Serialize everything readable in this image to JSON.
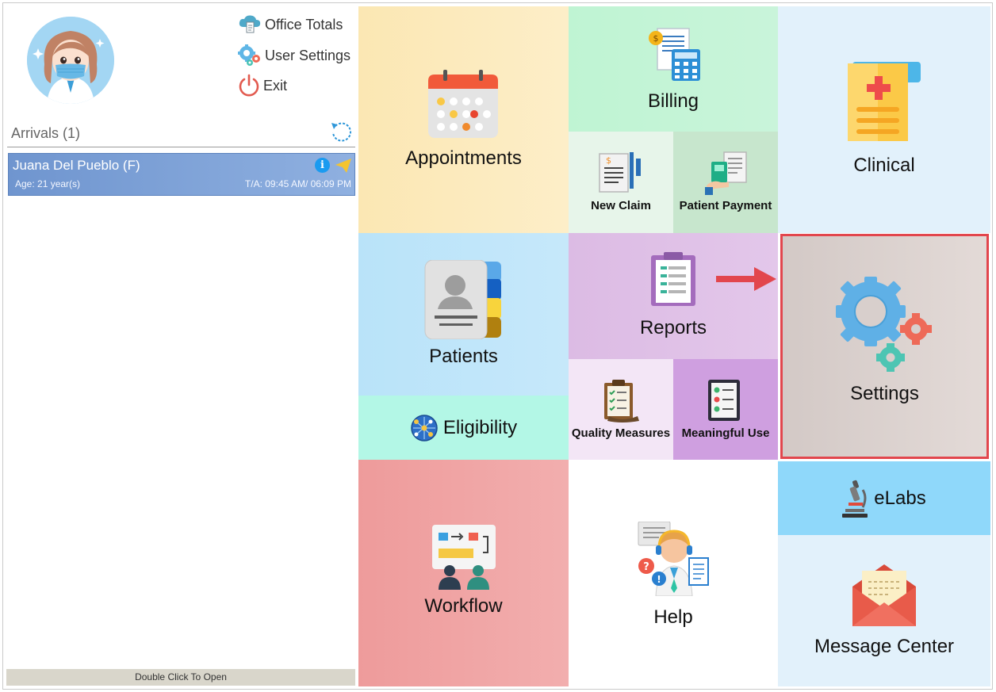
{
  "user_menu": {
    "office_totals": "Office Totals",
    "user_settings": "User Settings",
    "exit": "Exit"
  },
  "arrivals": {
    "title": "Arrivals (1)",
    "patients": [
      {
        "name": "Juana Del Pueblo (F)",
        "age": "Age: 21 year(s)",
        "time": "T/A: 09:45 AM/ 06:09 PM"
      }
    ],
    "footer": "Double Click To Open"
  },
  "tiles": {
    "appointments": "Appointments",
    "billing": "Billing",
    "new_claim": "New Claim",
    "patient_payment": "Patient Payment",
    "clinical": "Clinical",
    "patients": "Patients",
    "eligibility": "Eligibility",
    "reports": "Reports",
    "quality_measures": "Quality Measures",
    "meaningful_use": "Meaningful Use",
    "settings": "Settings",
    "workflow": "Workflow",
    "help": "Help",
    "elabs": "eLabs",
    "message_center": "Message Center"
  },
  "icons": {
    "office_totals": "cloud-report-icon",
    "user_settings": "gears-icon",
    "exit": "power-icon",
    "refresh": "refresh-icon",
    "info": "info-icon",
    "send": "paper-plane-icon"
  },
  "colors": {
    "highlight_border": "#e2464d",
    "arrow": "#e2464d",
    "patient_row": "#7a9fd6"
  }
}
